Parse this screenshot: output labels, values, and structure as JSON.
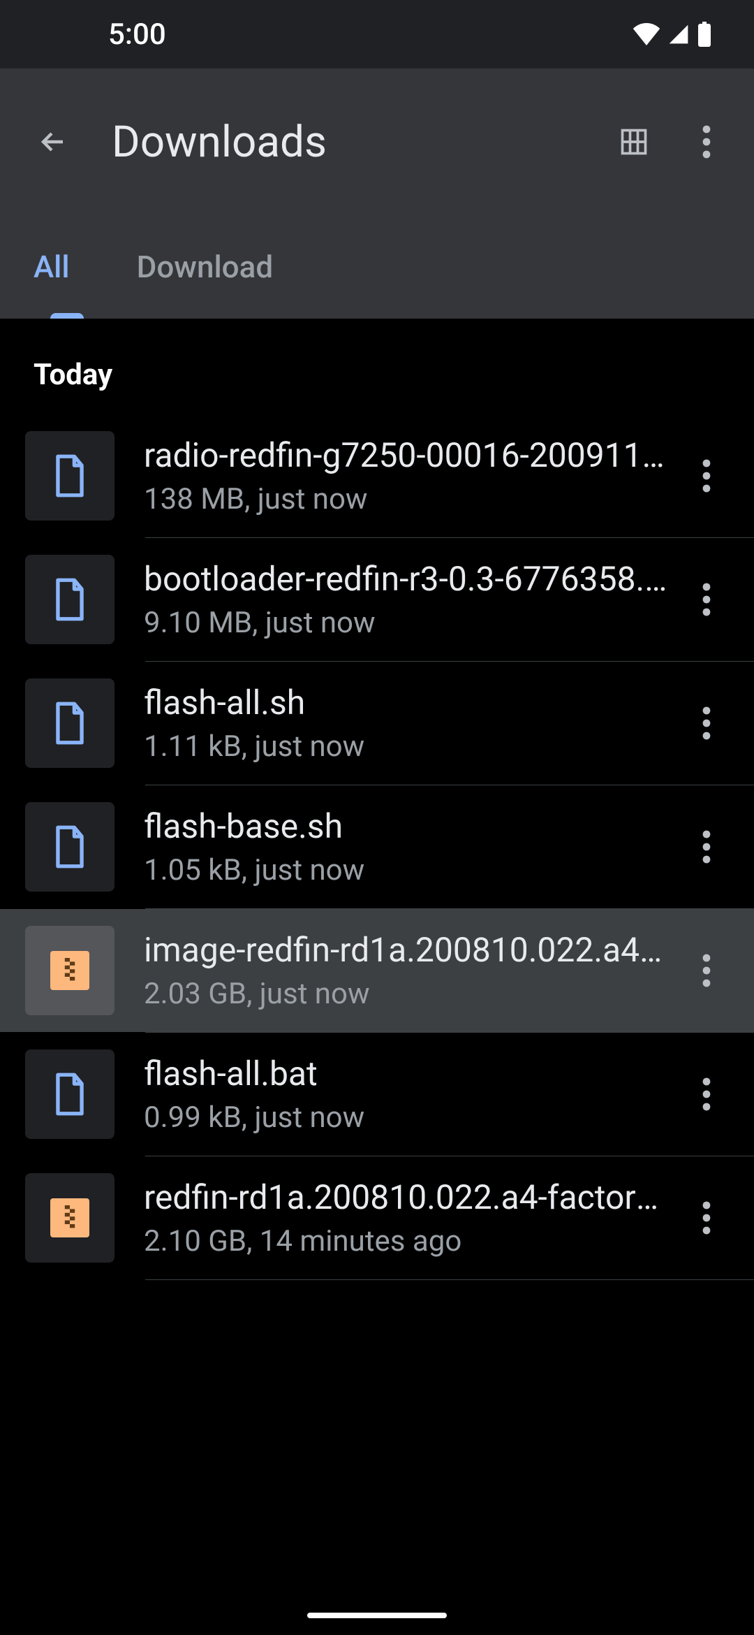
{
  "status": {
    "time": "5:00"
  },
  "header": {
    "title": "Downloads"
  },
  "tabs": [
    {
      "label": "All",
      "active": true
    },
    {
      "label": "Download",
      "active": false
    }
  ],
  "section": {
    "label": "Today"
  },
  "files": [
    {
      "name": "radio-redfin-g7250-00016-200911-…",
      "meta": "138 MB, just now",
      "type": "file",
      "highlighted": false
    },
    {
      "name": "bootloader-redfin-r3-0.3-6776358.i…",
      "meta": "9.10 MB, just now",
      "type": "file",
      "highlighted": false
    },
    {
      "name": "flash-all.sh",
      "meta": "1.11 kB, just now",
      "type": "file",
      "highlighted": false
    },
    {
      "name": "flash-base.sh",
      "meta": "1.05 kB, just now",
      "type": "file",
      "highlighted": false
    },
    {
      "name": "image-redfin-rd1a.200810.022.a4.…",
      "meta": "2.03 GB, just now",
      "type": "zip",
      "highlighted": true
    },
    {
      "name": "flash-all.bat",
      "meta": "0.99 kB, just now",
      "type": "file",
      "highlighted": false
    },
    {
      "name": "redfin-rd1a.200810.022.a4-factory-…",
      "meta": "2.10 GB, 14 minutes ago",
      "type": "zip",
      "highlighted": false
    }
  ]
}
